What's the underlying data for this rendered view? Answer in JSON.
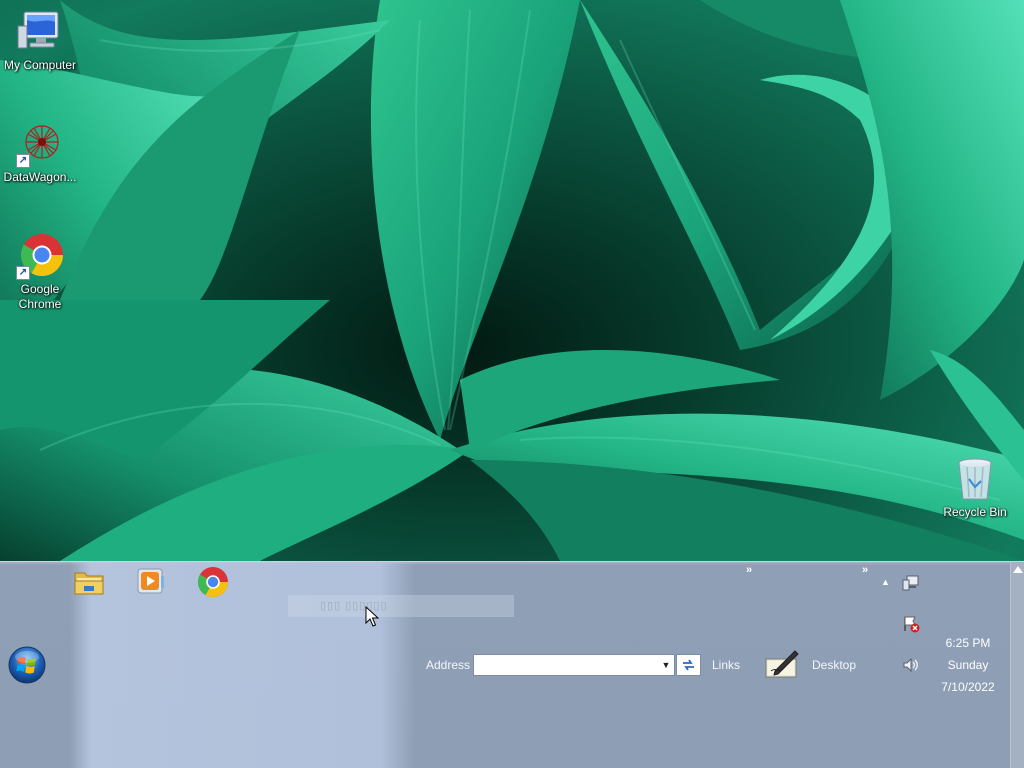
{
  "desktop": {
    "icons": [
      {
        "label": "My Computer",
        "icon": "my-computer-icon"
      },
      {
        "label": "DataWagon...",
        "icon": "datawagon-icon"
      },
      {
        "label": "Google\nChrome",
        "icon": "chrome-icon"
      },
      {
        "label": "Recycle Bin",
        "icon": "recycle-bin-icon"
      }
    ]
  },
  "taskbar": {
    "quick_launch": [
      {
        "icon": "file-explorer-icon"
      },
      {
        "icon": "media-player-icon"
      },
      {
        "icon": "chrome-icon"
      }
    ],
    "address_label": "Address",
    "address_value": "",
    "links_label": "Links",
    "desktop_label": "Desktop",
    "clock": {
      "time": "6:25 PM",
      "day": "Sunday",
      "date": "7/10/2022"
    },
    "chevron": "»",
    "tray_up": "▲"
  },
  "colors": {
    "taskbar": "#8e9eb4",
    "wallpaper_dark": "#021a12",
    "wallpaper_leaf": "#1aa37a"
  }
}
